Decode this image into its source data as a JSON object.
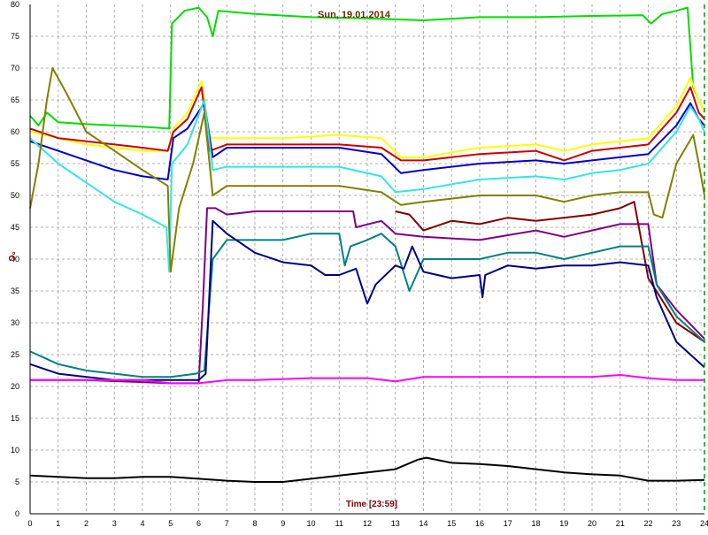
{
  "chart_data": {
    "type": "line",
    "title": "Sun, 19.01.2014",
    "xlabel": "Time [23:59]",
    "ylabel": "°C",
    "xlim": [
      0,
      24
    ],
    "ylim": [
      0,
      80
    ],
    "x_ticks": [
      0,
      1,
      2,
      3,
      4,
      5,
      6,
      7,
      8,
      9,
      10,
      11,
      12,
      13,
      14,
      15,
      16,
      17,
      18,
      19,
      20,
      21,
      22,
      23,
      24
    ],
    "y_ticks": [
      0,
      5,
      10,
      15,
      20,
      25,
      30,
      35,
      40,
      45,
      50,
      55,
      60,
      65,
      70,
      75,
      80
    ],
    "grid": true,
    "legend": "none",
    "colors": {
      "title": "#6b2a00",
      "xlabel": "#7a0000",
      "ylabel": "#7a0000",
      "grid": "#999999",
      "right_marker": "#009900"
    },
    "series": [
      {
        "color": "#00dd00",
        "points": [
          [
            0,
            62.5
          ],
          [
            0.3,
            61
          ],
          [
            0.6,
            63
          ],
          [
            1,
            61.5
          ],
          [
            2,
            61.2
          ],
          [
            3,
            61
          ],
          [
            4,
            60.8
          ],
          [
            4.95,
            60.5
          ],
          [
            5.05,
            77
          ],
          [
            5.5,
            79
          ],
          [
            6,
            79.5
          ],
          [
            6.3,
            78
          ],
          [
            6.5,
            75
          ],
          [
            6.7,
            79
          ],
          [
            8,
            78.5
          ],
          [
            10,
            78
          ],
          [
            12,
            77.8
          ],
          [
            14,
            77.5
          ],
          [
            16,
            78
          ],
          [
            18,
            78
          ],
          [
            20,
            78.2
          ],
          [
            21.8,
            78.3
          ],
          [
            22.1,
            77
          ],
          [
            22.5,
            78.5
          ],
          [
            23,
            79
          ],
          [
            23.4,
            79.5
          ],
          [
            23.6,
            67
          ],
          [
            24,
            63
          ]
        ]
      },
      {
        "color": "#ffff00",
        "points": [
          [
            0,
            60
          ],
          [
            1,
            59
          ],
          [
            2,
            58
          ],
          [
            3,
            57.5
          ],
          [
            4,
            57
          ],
          [
            4.9,
            57
          ],
          [
            5.1,
            60.5
          ],
          [
            5.6,
            63
          ],
          [
            6.1,
            68
          ],
          [
            6.4,
            59
          ],
          [
            7,
            59
          ],
          [
            9,
            59
          ],
          [
            11,
            59.5
          ],
          [
            12.5,
            59
          ],
          [
            13.2,
            56
          ],
          [
            14,
            56
          ],
          [
            16,
            57.5
          ],
          [
            18,
            58
          ],
          [
            19,
            57
          ],
          [
            20,
            58
          ],
          [
            21,
            58.5
          ],
          [
            22,
            59
          ],
          [
            23,
            64
          ],
          [
            23.5,
            68.5
          ],
          [
            23.8,
            65
          ],
          [
            24,
            63
          ]
        ]
      },
      {
        "color": "#cc0000",
        "points": [
          [
            0,
            60.5
          ],
          [
            1,
            59
          ],
          [
            2,
            58.5
          ],
          [
            3,
            58
          ],
          [
            4,
            57.5
          ],
          [
            4.9,
            57
          ],
          [
            5.1,
            60
          ],
          [
            5.6,
            62
          ],
          [
            6.1,
            67
          ],
          [
            6.4,
            57
          ],
          [
            7,
            58
          ],
          [
            9,
            58
          ],
          [
            11,
            58
          ],
          [
            12.5,
            57.5
          ],
          [
            13.2,
            55.5
          ],
          [
            14,
            55.5
          ],
          [
            16,
            56.5
          ],
          [
            18,
            57
          ],
          [
            19,
            55.5
          ],
          [
            20,
            57
          ],
          [
            21,
            57.5
          ],
          [
            22,
            58
          ],
          [
            23,
            63
          ],
          [
            23.5,
            67
          ],
          [
            23.8,
            63
          ],
          [
            24,
            62
          ]
        ]
      },
      {
        "color": "#0000cc",
        "points": [
          [
            0,
            58.5
          ],
          [
            1,
            57
          ],
          [
            2,
            55.5
          ],
          [
            3,
            54
          ],
          [
            4,
            53
          ],
          [
            4.9,
            52.5
          ],
          [
            5.1,
            59
          ],
          [
            5.6,
            60.5
          ],
          [
            6.2,
            64.5
          ],
          [
            6.5,
            56
          ],
          [
            7,
            57.5
          ],
          [
            9,
            57.5
          ],
          [
            11,
            57.5
          ],
          [
            12.5,
            56.5
          ],
          [
            13.2,
            53.5
          ],
          [
            14,
            54
          ],
          [
            16,
            55
          ],
          [
            18,
            55.5
          ],
          [
            19,
            55
          ],
          [
            20,
            55.5
          ],
          [
            21,
            56
          ],
          [
            22,
            56.5
          ],
          [
            23,
            61
          ],
          [
            23.5,
            64.5
          ],
          [
            23.8,
            62
          ],
          [
            24,
            61
          ]
        ]
      },
      {
        "color": "#33e5e5",
        "points": [
          [
            0,
            59
          ],
          [
            1,
            55
          ],
          [
            2,
            52
          ],
          [
            3,
            49
          ],
          [
            4,
            47
          ],
          [
            4.85,
            45
          ],
          [
            4.95,
            38
          ],
          [
            5.05,
            55
          ],
          [
            5.6,
            58
          ],
          [
            6.2,
            65
          ],
          [
            6.5,
            54
          ],
          [
            7,
            54.5
          ],
          [
            9,
            54.5
          ],
          [
            11,
            54.5
          ],
          [
            12.5,
            53
          ],
          [
            13,
            50.5
          ],
          [
            14,
            51
          ],
          [
            16,
            52.5
          ],
          [
            18,
            53
          ],
          [
            19,
            52.5
          ],
          [
            20,
            53.5
          ],
          [
            21,
            54
          ],
          [
            22,
            55
          ],
          [
            23,
            60
          ],
          [
            23.5,
            64
          ],
          [
            23.8,
            62
          ],
          [
            24,
            60
          ]
        ]
      },
      {
        "color": "#808000",
        "points": [
          [
            0,
            48
          ],
          [
            0.3,
            55
          ],
          [
            0.6,
            65
          ],
          [
            0.8,
            70
          ],
          [
            1.3,
            66
          ],
          [
            2,
            60
          ],
          [
            3,
            57
          ],
          [
            4,
            54
          ],
          [
            4.9,
            51.5
          ],
          [
            5,
            38
          ],
          [
            5.3,
            48
          ],
          [
            5.8,
            55
          ],
          [
            6.2,
            63
          ],
          [
            6.5,
            50
          ],
          [
            7,
            51.5
          ],
          [
            9,
            51.5
          ],
          [
            11,
            51.5
          ],
          [
            12.5,
            50.5
          ],
          [
            13.2,
            48.5
          ],
          [
            14,
            49
          ],
          [
            16,
            50
          ],
          [
            18,
            50
          ],
          [
            19,
            49
          ],
          [
            20,
            50
          ],
          [
            21,
            50.5
          ],
          [
            22,
            50.5
          ],
          [
            22.2,
            47
          ],
          [
            22.5,
            46.5
          ],
          [
            23,
            55
          ],
          [
            23.6,
            59.5
          ],
          [
            23.8,
            55
          ],
          [
            24,
            50
          ]
        ]
      },
      {
        "color": "#800080",
        "points": [
          [
            0,
            21
          ],
          [
            2,
            21
          ],
          [
            5,
            20.5
          ],
          [
            6,
            20.5
          ],
          [
            6.15,
            33
          ],
          [
            6.3,
            48
          ],
          [
            6.6,
            48
          ],
          [
            7,
            47
          ],
          [
            8,
            47.5
          ],
          [
            10,
            47.5
          ],
          [
            11.5,
            47.5
          ],
          [
            11.6,
            45
          ],
          [
            12.5,
            46
          ],
          [
            13,
            44
          ],
          [
            14,
            43.5
          ],
          [
            16,
            43
          ],
          [
            18,
            44.5
          ],
          [
            19,
            43.5
          ],
          [
            20,
            44.5
          ],
          [
            21,
            45.5
          ],
          [
            22,
            45.5
          ],
          [
            22.3,
            36
          ],
          [
            23,
            32
          ],
          [
            24,
            27.5
          ]
        ]
      },
      {
        "color": "#800000",
        "points": [
          [
            13,
            47.5
          ],
          [
            13.5,
            47
          ],
          [
            14,
            44.5
          ],
          [
            15,
            46
          ],
          [
            16,
            45.5
          ],
          [
            17,
            46.5
          ],
          [
            18,
            46
          ],
          [
            19,
            46.5
          ],
          [
            20,
            47
          ],
          [
            21,
            48
          ],
          [
            21.5,
            49
          ],
          [
            22,
            37
          ],
          [
            23,
            30
          ],
          [
            24,
            27
          ]
        ]
      },
      {
        "color": "#008080",
        "points": [
          [
            0,
            25.5
          ],
          [
            1,
            23.5
          ],
          [
            2,
            22.5
          ],
          [
            3,
            22
          ],
          [
            4,
            21.5
          ],
          [
            5,
            21.5
          ],
          [
            5.9,
            22
          ],
          [
            6.2,
            22.5
          ],
          [
            6.5,
            40
          ],
          [
            7,
            43
          ],
          [
            8,
            43
          ],
          [
            9,
            43
          ],
          [
            10,
            44
          ],
          [
            11,
            44
          ],
          [
            11.2,
            39
          ],
          [
            11.4,
            42
          ],
          [
            12,
            43
          ],
          [
            12.5,
            44
          ],
          [
            13,
            42
          ],
          [
            13.5,
            35
          ],
          [
            14,
            40
          ],
          [
            16,
            40
          ],
          [
            17,
            41
          ],
          [
            18,
            41
          ],
          [
            19,
            40
          ],
          [
            20,
            41
          ],
          [
            21,
            42
          ],
          [
            22,
            42
          ],
          [
            22.3,
            36
          ],
          [
            23,
            31
          ],
          [
            24,
            27
          ]
        ]
      },
      {
        "color": "#000080",
        "points": [
          [
            0,
            23.5
          ],
          [
            1,
            22
          ],
          [
            2,
            21.5
          ],
          [
            3,
            21
          ],
          [
            4,
            21
          ],
          [
            5,
            21
          ],
          [
            6,
            21
          ],
          [
            6.25,
            22
          ],
          [
            6.5,
            46
          ],
          [
            7,
            44
          ],
          [
            8,
            41
          ],
          [
            9,
            39.5
          ],
          [
            10,
            39
          ],
          [
            10.5,
            37.5
          ],
          [
            11,
            37.5
          ],
          [
            11.6,
            38.5
          ],
          [
            12,
            33
          ],
          [
            12.3,
            36
          ],
          [
            13,
            39
          ],
          [
            13.3,
            38.5
          ],
          [
            13.6,
            42
          ],
          [
            14,
            38
          ],
          [
            15,
            37
          ],
          [
            16,
            37.5
          ],
          [
            16.1,
            34
          ],
          [
            16.2,
            37.5
          ],
          [
            17,
            39
          ],
          [
            18,
            38.5
          ],
          [
            19,
            39
          ],
          [
            20,
            39
          ],
          [
            21,
            39.5
          ],
          [
            22,
            39
          ],
          [
            22.3,
            34
          ],
          [
            23,
            27
          ],
          [
            24,
            23
          ]
        ]
      },
      {
        "color": "#ff00ff",
        "points": [
          [
            0,
            21
          ],
          [
            2,
            21
          ],
          [
            4,
            21
          ],
          [
            5,
            20.5
          ],
          [
            6,
            20.5
          ],
          [
            7,
            21
          ],
          [
            8,
            21
          ],
          [
            10,
            21.3
          ],
          [
            12,
            21.3
          ],
          [
            13,
            20.8
          ],
          [
            14,
            21.5
          ],
          [
            16,
            21.5
          ],
          [
            18,
            21.5
          ],
          [
            20,
            21.5
          ],
          [
            21,
            21.8
          ],
          [
            22,
            21.3
          ],
          [
            23,
            21
          ],
          [
            24,
            21
          ]
        ]
      },
      {
        "color": "#000000",
        "points": [
          [
            0,
            6
          ],
          [
            1,
            5.8
          ],
          [
            2,
            5.6
          ],
          [
            3,
            5.6
          ],
          [
            4,
            5.8
          ],
          [
            5,
            5.8
          ],
          [
            6,
            5.5
          ],
          [
            7,
            5.2
          ],
          [
            8,
            5
          ],
          [
            9,
            5
          ],
          [
            10,
            5.5
          ],
          [
            11,
            6
          ],
          [
            12,
            6.5
          ],
          [
            13,
            7
          ],
          [
            13.8,
            8.5
          ],
          [
            14.1,
            8.8
          ],
          [
            15,
            8
          ],
          [
            16,
            7.8
          ],
          [
            17,
            7.5
          ],
          [
            18,
            7
          ],
          [
            19,
            6.5
          ],
          [
            20,
            6.2
          ],
          [
            21,
            6
          ],
          [
            22,
            5.2
          ],
          [
            23,
            5.2
          ],
          [
            24,
            5.3
          ]
        ]
      }
    ]
  }
}
